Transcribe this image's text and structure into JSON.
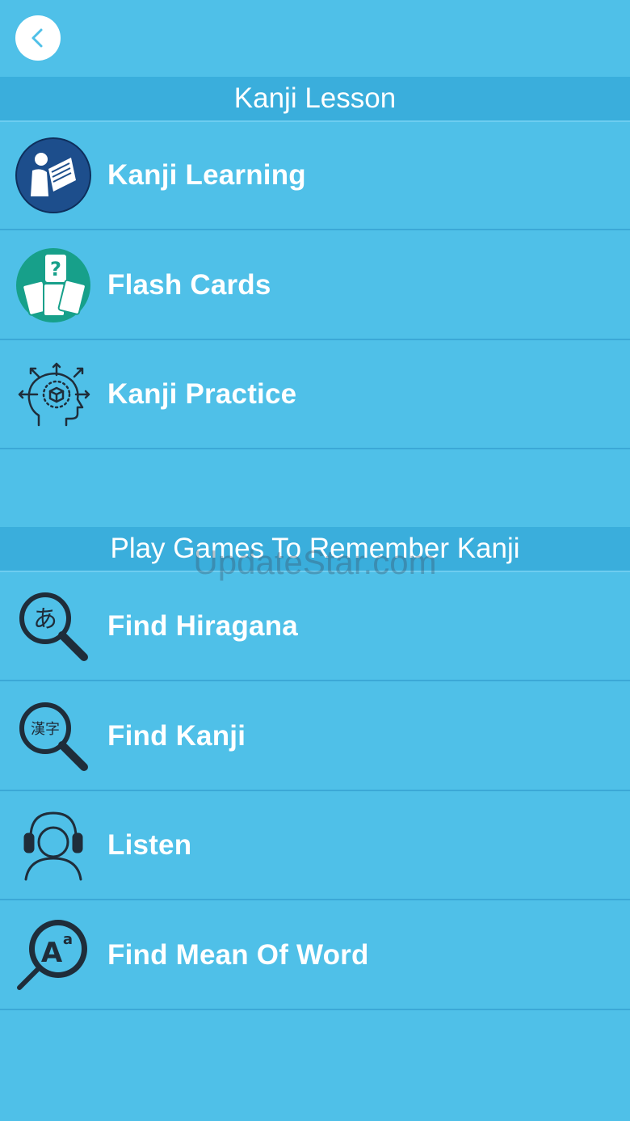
{
  "back_button": {
    "icon": "chevron-left-icon"
  },
  "sections": {
    "lesson": {
      "title": "Kanji Lesson",
      "items": [
        {
          "label": "Kanji Learning",
          "icon": "reading-person-icon"
        },
        {
          "label": "Flash Cards",
          "icon": "flash-cards-icon"
        },
        {
          "label": "Kanji Practice",
          "icon": "mind-practice-icon"
        }
      ]
    },
    "games": {
      "title": "Play Games To Remember Kanji",
      "items": [
        {
          "label": "Find Hiragana",
          "icon": "hiragana-magnifier-icon",
          "glyph": "あ"
        },
        {
          "label": "Find Kanji",
          "icon": "kanji-magnifier-icon",
          "glyph": "漢字"
        },
        {
          "label": "Listen",
          "icon": "headphones-person-icon"
        },
        {
          "label": "Find Mean Of Word",
          "icon": "font-magnifier-icon",
          "glyph": "A",
          "glyph_sup": "a"
        }
      ]
    }
  },
  "watermark": "UpdateStar.com",
  "colors": {
    "background": "#4fc0e8",
    "header": "#3aaedc",
    "text": "#ffffff",
    "icon_dark": "#1f2d3a",
    "icon_navy": "#1d4e8c",
    "icon_teal": "#17a08a"
  }
}
